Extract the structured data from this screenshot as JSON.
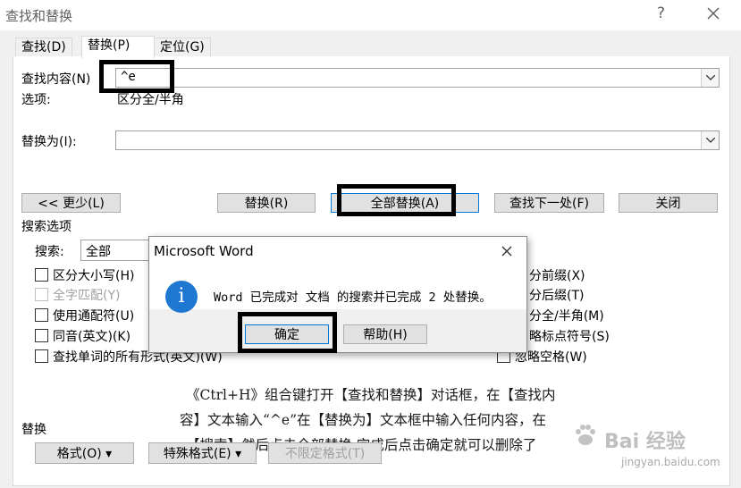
{
  "window": {
    "title": "查找和替换",
    "help_glyph": "?"
  },
  "tabs": [
    {
      "label": "查找(D)",
      "active": false
    },
    {
      "label": "替换(P)",
      "active": true
    },
    {
      "label": "定位(G)",
      "active": false
    }
  ],
  "find": {
    "label": "查找内容(N)",
    "value": "^e",
    "options_label": "选项:",
    "options_value": "区分全/半角"
  },
  "replace": {
    "label": "替换为(I):",
    "value": ""
  },
  "buttons": {
    "less": "<< 更少(L)",
    "replace": "替换(R)",
    "replace_all": "全部替换(A)",
    "find_next": "查找下一处(F)",
    "close": "关闭"
  },
  "search_options": {
    "section_label": "搜索选项",
    "search_label": "搜索:",
    "search_value": "全部",
    "left_checks": [
      {
        "label": "区分大小写(H)",
        "checked": false,
        "disabled": false
      },
      {
        "label": "全字匹配(Y)",
        "checked": false,
        "disabled": true
      },
      {
        "label": "使用通配符(U)",
        "checked": false,
        "disabled": false
      },
      {
        "label": "同音(英文)(K)",
        "checked": false,
        "disabled": false
      },
      {
        "label": "查找单词的所有形式(英文)(W)",
        "checked": false,
        "disabled": false
      }
    ],
    "right_checks": [
      {
        "label": "分前缀(X)"
      },
      {
        "label": "分后缀(T)"
      },
      {
        "label": "分全/半角(M)"
      },
      {
        "label": "略标点符号(S)"
      },
      {
        "label": "忽略空格(W)"
      }
    ]
  },
  "replace_section": {
    "label": "替换",
    "format_btn": "格式(O) ▾",
    "special_btn": "特殊格式(E) ▾",
    "no_format_btn": "不限定格式(T)"
  },
  "msgbox": {
    "title": "Microsoft Word",
    "message": "Word 已完成对 文档 的搜索并已完成 2 处替换。",
    "ok": "确定",
    "help": "帮助(H)"
  },
  "caption": {
    "line1": "《Ctrl+H》组合键打开【查找和替换】对话框，在【查找内",
    "line2": "容】文本输入“^e”在【替换为】文本框中输入任何内容，在",
    "line3": "【搜索】然后点击全部替换,完成后点击确定就可以删除了"
  },
  "watermark": {
    "text": "Bai 经验",
    "url": "jingyan.baidu.com"
  },
  "colors": {
    "accent": "#0078d7",
    "info_icon": "#1e78d2",
    "annotation": "#000000"
  }
}
